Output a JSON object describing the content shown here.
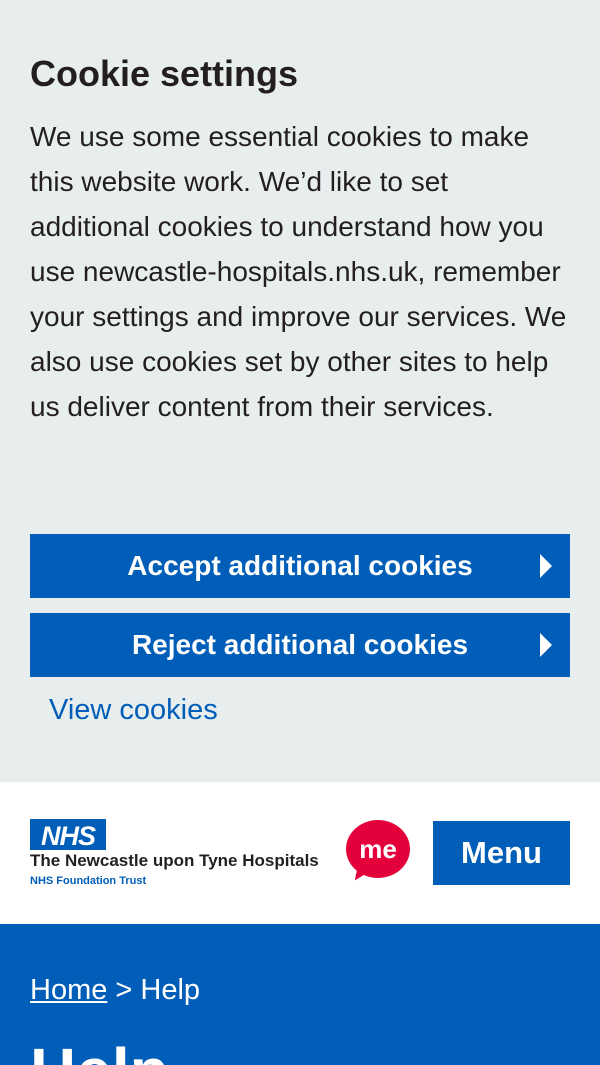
{
  "cookie_banner": {
    "title": "Cookie settings",
    "body": "We use some essential cookies to make this website work. We’d like to set additional cookies to understand how you use newcastle-hospitals.nhs.uk, remember your settings and improve our services. We also use cookies set by other sites to help us deliver content from their services.",
    "accept_label": "Accept additional cookies",
    "reject_label": "Reject additional cookies",
    "view_label": "View cookies",
    "button_icon": "chevron-right-triangle-icon"
  },
  "header": {
    "logo_mark": "NHS",
    "trust_name": "The Newcastle upon Tyne Hospitals",
    "trust_sub": "NHS Foundation Trust",
    "badge_text": "me",
    "menu_label": "Menu"
  },
  "hero": {
    "breadcrumb_home": "Home",
    "breadcrumb_sep": ">",
    "breadcrumb_current": "Help",
    "title": "Help"
  },
  "colors": {
    "nhs_blue": "#005eb8",
    "banner_bg": "#e8edee",
    "text": "#231f20",
    "badge_red": "#e4003b"
  }
}
